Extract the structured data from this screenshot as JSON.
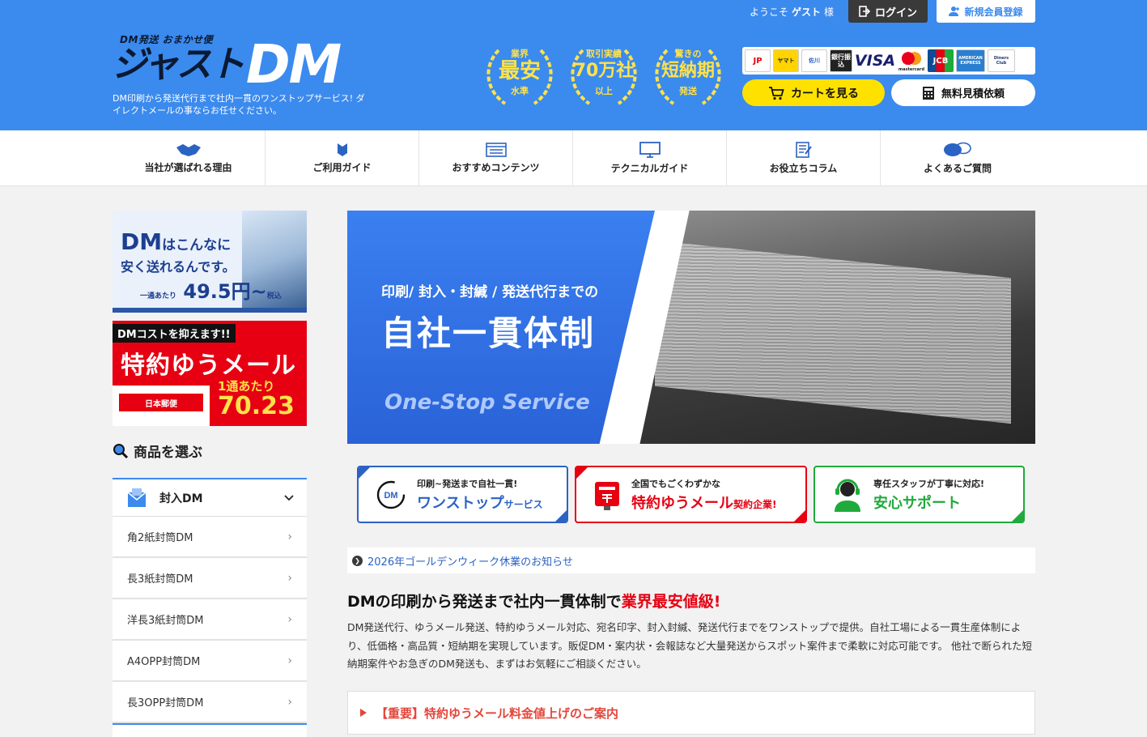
{
  "header": {
    "logo_tagline": "DM発送 おまかせ便",
    "logo_jp": "ジャスト",
    "logo_dm": "DM",
    "description": "DM印刷から発送代行まで社内一貫のワンストップサービス! ダイレクトメールの事ならお任せください。",
    "welcome_prefix": "ようこそ",
    "welcome_name": "ゲスト",
    "welcome_suffix": "様",
    "login_label": "ログイン",
    "register_label": "新規会員登録",
    "badges": [
      {
        "top": "業界",
        "mid": "最安",
        "bottom": "水準"
      },
      {
        "top": "取引実績",
        "mid": "70万社",
        "bottom": "以上"
      },
      {
        "top": "驚きの",
        "mid": "短納期",
        "bottom": "発送"
      }
    ],
    "payments": [
      "JP",
      "ヤマト",
      "佐川",
      "銀行振込",
      "VISA",
      "mastercard",
      "JCB",
      "AMERICAN EXPRESS",
      "Diners Club"
    ],
    "cart_label": "カートを見る",
    "quote_label": "無料見積依頼"
  },
  "nav": {
    "items": [
      {
        "label": "当社が選ばれる理由",
        "icon": "handshake-icon"
      },
      {
        "label": "ご利用ガイド",
        "icon": "guide-icon"
      },
      {
        "label": "おすすめコンテンツ",
        "icon": "content-icon"
      },
      {
        "label": "テクニカルガイド",
        "icon": "monitor-icon"
      },
      {
        "label": "お役立ちコラム",
        "icon": "column-icon"
      },
      {
        "label": "よくあるご質問",
        "icon": "faq-icon"
      }
    ]
  },
  "sidebar": {
    "ad1": {
      "dm": "DM",
      "line1_rest": "はこんなに",
      "line2": "安く送れるんです。",
      "per": "一通あたり",
      "price": "49.5円~",
      "tax": "税込"
    },
    "ad2": {
      "tag": "DMコストを抑えます!!",
      "title": "特約ゆうメール",
      "per": "1通あたり",
      "price": "70.23円~",
      "post_sign": "日本郵便"
    },
    "select_heading": "商品を選ぶ",
    "category": "封入DM",
    "items": [
      "角2紙封筒DM",
      "長3紙封筒DM",
      "洋長3紙封筒DM",
      "A4OPP封筒DM",
      "長3OPP封筒DM"
    ]
  },
  "hero": {
    "sub": "印刷/ 封入・封緘 / 発送代行までの",
    "title": "自社一貫体制",
    "english": "One-Stop Service"
  },
  "features": [
    {
      "small": "印刷~発送まで自社一貫!",
      "big": "ワンストップ",
      "big_small": "サービス",
      "color": "#2b63c4"
    },
    {
      "small": "全国でもごくわずかな",
      "big": "特約ゆうメール",
      "big_small": "契約企業!",
      "color": "#e60012"
    },
    {
      "small": "専任スタッフが丁寧に対応!",
      "big": "安心サポート",
      "big_small": "",
      "color": "#1faa3c"
    }
  ],
  "notice": "2026年ゴールデンウィーク休業のお知らせ",
  "intro": {
    "heading_main": "DMの印刷から発送まで社内一貫体制で",
    "heading_accent": "業界最安値級!",
    "body": "DM発送代行、ゆうメール発送、特約ゆうメール対応、宛名印字、封入封緘、発送代行までをワンストップで提供。自社工場による一貫生産体制により、低価格・高品質・短納期を実現しています。販促DM・案内状・会報誌など大量発送からスポット案件まで柔軟に対応可能です。 他社で断られた短納期案件やお急ぎのDM発送も、まずはお気軽にご相談ください。"
  },
  "important": "【重要】特約ゆうメール料金値上げのご案内",
  "colors": {
    "header_blue": "#3b8aee",
    "accent_red": "#e60012",
    "cart_yellow": "#ffe100",
    "link_blue": "#2b63c4"
  }
}
